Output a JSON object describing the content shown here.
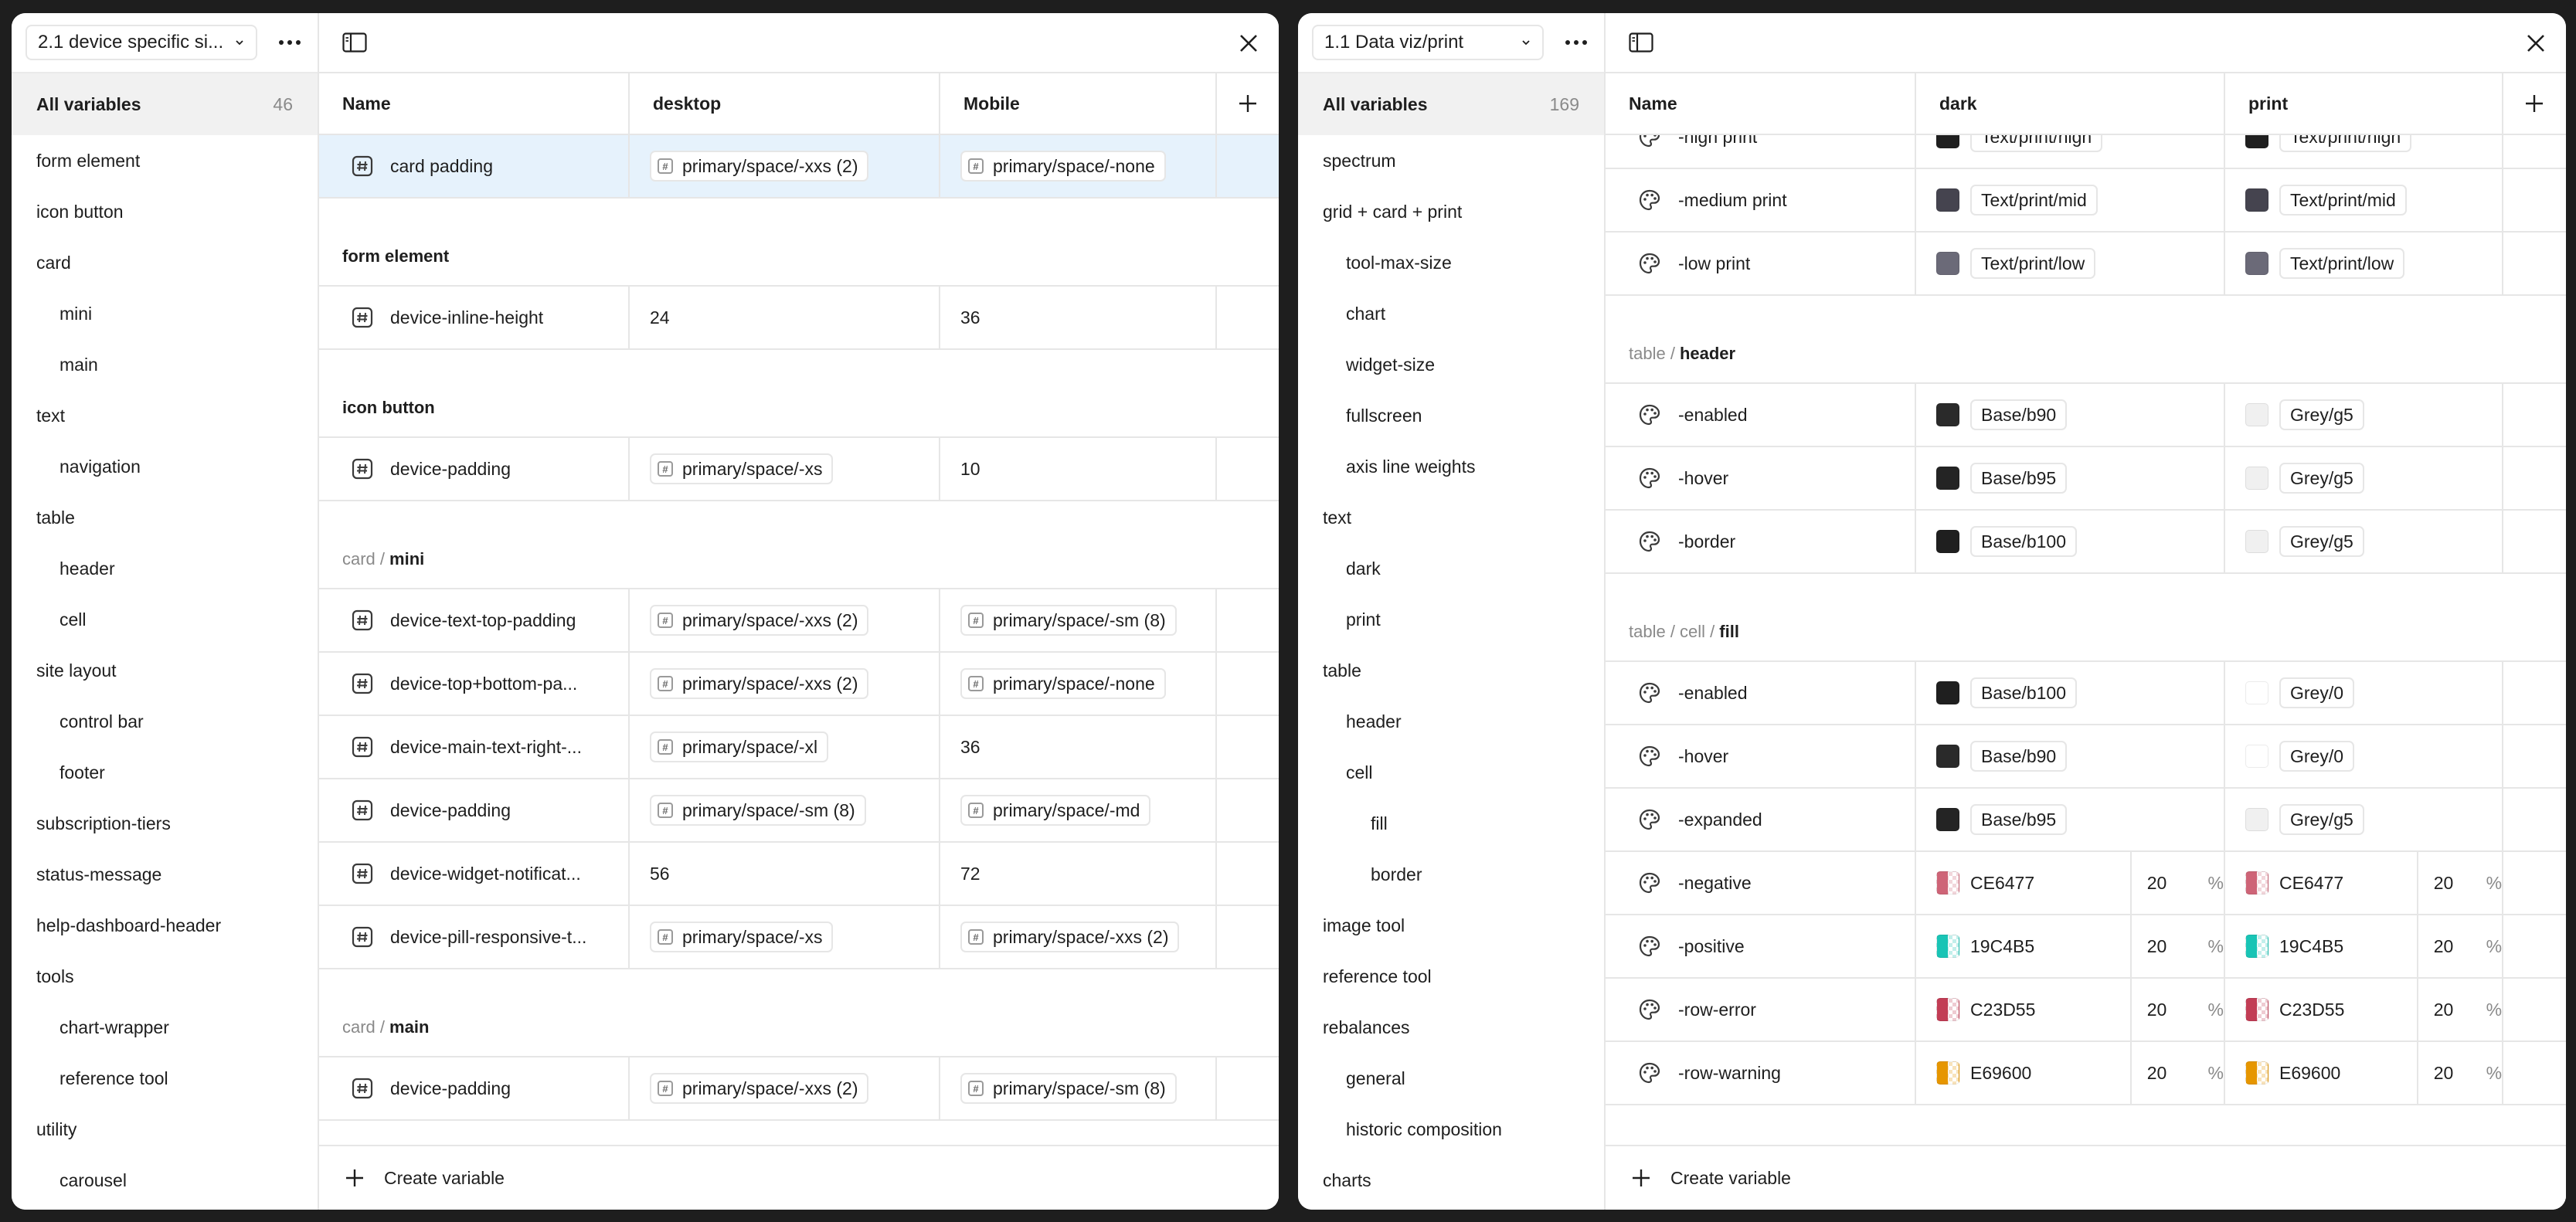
{
  "left": {
    "collection": "2.1 device specific si...",
    "all_variables": {
      "label": "All variables",
      "count": "46"
    },
    "groups": [
      {
        "label": "form element",
        "level": 0
      },
      {
        "label": "icon button",
        "level": 0
      },
      {
        "label": "card",
        "level": 0
      },
      {
        "label": "mini",
        "level": 1
      },
      {
        "label": "main",
        "level": 1
      },
      {
        "label": "text",
        "level": 0
      },
      {
        "label": "navigation",
        "level": 1
      },
      {
        "label": "table",
        "level": 0
      },
      {
        "label": "header",
        "level": 1
      },
      {
        "label": "cell",
        "level": 1
      },
      {
        "label": "site layout",
        "level": 0
      },
      {
        "label": "control bar",
        "level": 1
      },
      {
        "label": "footer",
        "level": 1
      },
      {
        "label": "subscription-tiers",
        "level": 0
      },
      {
        "label": "status-message",
        "level": 0
      },
      {
        "label": "help-dashboard-header",
        "level": 0
      },
      {
        "label": "tools",
        "level": 0
      },
      {
        "label": "chart-wrapper",
        "level": 1
      },
      {
        "label": "reference tool",
        "level": 1
      },
      {
        "label": "utility",
        "level": 0
      },
      {
        "label": "carousel",
        "level": 1
      }
    ],
    "columns": [
      "Name",
      "desktop",
      "Mobile"
    ],
    "blocks": [
      {
        "rows": [
          {
            "name": "card padding",
            "selected": true,
            "v1": {
              "kind": "alias",
              "text": "primary/space/-xxs (2)"
            },
            "v2": {
              "kind": "alias",
              "text": "primary/space/-none"
            }
          }
        ]
      },
      {
        "heading": {
          "path": "",
          "leaf": "form element"
        },
        "rows": [
          {
            "name": "device-inline-height",
            "v1": {
              "kind": "num",
              "text": "24"
            },
            "v2": {
              "kind": "num",
              "text": "36"
            }
          }
        ]
      },
      {
        "heading": {
          "path": "",
          "leaf": "icon button"
        },
        "rows": [
          {
            "name": "device-padding",
            "v1": {
              "kind": "alias",
              "text": "primary/space/-xs"
            },
            "v2": {
              "kind": "num",
              "text": "10"
            }
          }
        ]
      },
      {
        "heading": {
          "path": "card /",
          "leaf": "mini"
        },
        "rows": [
          {
            "name": "device-text-top-padding",
            "v1": {
              "kind": "alias",
              "text": "primary/space/-xxs (2)"
            },
            "v2": {
              "kind": "alias",
              "text": "primary/space/-sm (8)"
            }
          },
          {
            "name": "device-top+bottom-pa...",
            "v1": {
              "kind": "alias",
              "text": "primary/space/-xxs (2)"
            },
            "v2": {
              "kind": "alias",
              "text": "primary/space/-none"
            }
          },
          {
            "name": "device-main-text-right-...",
            "v1": {
              "kind": "alias",
              "text": "primary/space/-xl"
            },
            "v2": {
              "kind": "num",
              "text": "36"
            }
          },
          {
            "name": "device-padding",
            "v1": {
              "kind": "alias",
              "text": "primary/space/-sm (8)"
            },
            "v2": {
              "kind": "alias",
              "text": "primary/space/-md"
            }
          },
          {
            "name": "device-widget-notificat...",
            "v1": {
              "kind": "num",
              "text": "56"
            },
            "v2": {
              "kind": "num",
              "text": "72"
            }
          },
          {
            "name": "device-pill-responsive-t...",
            "v1": {
              "kind": "alias",
              "text": "primary/space/-xs"
            },
            "v2": {
              "kind": "alias",
              "text": "primary/space/-xxs (2)"
            }
          }
        ]
      },
      {
        "heading": {
          "path": "card /",
          "leaf": "main"
        },
        "rows": [
          {
            "name": "device-padding",
            "v1": {
              "kind": "alias",
              "text": "primary/space/-xxs (2)"
            },
            "v2": {
              "kind": "alias",
              "text": "primary/space/-sm (8)"
            }
          }
        ]
      }
    ],
    "create_label": "Create variable"
  },
  "right": {
    "collection": "1.1 Data viz/print",
    "all_variables": {
      "label": "All variables",
      "count": "169"
    },
    "groups": [
      {
        "label": "spectrum",
        "level": 0
      },
      {
        "label": "grid + card + print",
        "level": 0
      },
      {
        "label": "tool-max-size",
        "level": 1
      },
      {
        "label": "chart",
        "level": 1
      },
      {
        "label": "widget-size",
        "level": 1
      },
      {
        "label": "fullscreen",
        "level": 1
      },
      {
        "label": "axis line weights",
        "level": 1
      },
      {
        "label": "text",
        "level": 0
      },
      {
        "label": "dark",
        "level": 1
      },
      {
        "label": "print",
        "level": 1
      },
      {
        "label": "table",
        "level": 0
      },
      {
        "label": "header",
        "level": 1
      },
      {
        "label": "cell",
        "level": 1
      },
      {
        "label": "fill",
        "level": 2
      },
      {
        "label": "border",
        "level": 2
      },
      {
        "label": "image tool",
        "level": 0
      },
      {
        "label": "reference tool",
        "level": 0
      },
      {
        "label": "rebalances",
        "level": 0
      },
      {
        "label": "general",
        "level": 1
      },
      {
        "label": "historic composition",
        "level": 1
      },
      {
        "label": "charts",
        "level": 0
      }
    ],
    "columns": [
      "Name",
      "dark",
      "print"
    ],
    "blocks": [
      {
        "rows": [
          {
            "name": "-high print",
            "v1": {
              "kind": "color",
              "swatch": "#1f1f1f",
              "text": "Text/print/high"
            },
            "v2": {
              "kind": "color",
              "swatch": "#1f1f1f",
              "text": "Text/print/high"
            }
          },
          {
            "name": "-medium print",
            "v1": {
              "kind": "color",
              "swatch": "#45444f",
              "text": "Text/print/mid"
            },
            "v2": {
              "kind": "color",
              "swatch": "#45444f",
              "text": "Text/print/mid"
            }
          },
          {
            "name": "-low print",
            "v1": {
              "kind": "color",
              "swatch": "#6b6a78",
              "text": "Text/print/low"
            },
            "v2": {
              "kind": "color",
              "swatch": "#6b6a78",
              "text": "Text/print/low"
            }
          }
        ]
      },
      {
        "heading": {
          "path": "table /",
          "leaf": "header"
        },
        "rows": [
          {
            "name": "-enabled",
            "v1": {
              "kind": "color",
              "swatch": "#2a2a2a",
              "text": "Base/b90"
            },
            "v2": {
              "kind": "color",
              "swatch": "#f0f0f0",
              "text": "Grey/g5"
            }
          },
          {
            "name": "-hover",
            "v1": {
              "kind": "color",
              "swatch": "#242424",
              "text": "Base/b95"
            },
            "v2": {
              "kind": "color",
              "swatch": "#f0f0f0",
              "text": "Grey/g5"
            }
          },
          {
            "name": "-border",
            "v1": {
              "kind": "color",
              "swatch": "#1f1f1f",
              "text": "Base/b100"
            },
            "v2": {
              "kind": "color",
              "swatch": "#f0f0f0",
              "text": "Grey/g5"
            }
          }
        ]
      },
      {
        "heading": {
          "path": "table / cell /",
          "leaf": "fill"
        },
        "rows": [
          {
            "name": "-enabled",
            "v1": {
              "kind": "color",
              "swatch": "#1f1f1f",
              "text": "Base/b100"
            },
            "v2": {
              "kind": "color",
              "swatch": "#ffffff",
              "text": "Grey/0"
            }
          },
          {
            "name": "-hover",
            "v1": {
              "kind": "color",
              "swatch": "#2a2a2a",
              "text": "Base/b90"
            },
            "v2": {
              "kind": "color",
              "swatch": "#ffffff",
              "text": "Grey/0"
            }
          },
          {
            "name": "-expanded",
            "v1": {
              "kind": "color",
              "swatch": "#242424",
              "text": "Base/b95"
            },
            "v2": {
              "kind": "color",
              "swatch": "#f0f0f0",
              "text": "Grey/g5"
            }
          },
          {
            "name": "-negative",
            "v1": {
              "kind": "hex",
              "swatch": "#CE6477",
              "text": "CE6477",
              "opacity": "20",
              "unit": "%"
            },
            "v2": {
              "kind": "hex",
              "swatch": "#CE6477",
              "text": "CE6477",
              "opacity": "20",
              "unit": "%"
            }
          },
          {
            "name": "-positive",
            "v1": {
              "kind": "hex",
              "swatch": "#19C4B5",
              "text": "19C4B5",
              "opacity": "20",
              "unit": "%"
            },
            "v2": {
              "kind": "hex",
              "swatch": "#19C4B5",
              "text": "19C4B5",
              "opacity": "20",
              "unit": "%"
            }
          },
          {
            "name": "-row-error",
            "v1": {
              "kind": "hex",
              "swatch": "#C23D55",
              "text": "C23D55",
              "opacity": "20",
              "unit": "%"
            },
            "v2": {
              "kind": "hex",
              "swatch": "#C23D55",
              "text": "C23D55",
              "opacity": "20",
              "unit": "%"
            }
          },
          {
            "name": "-row-warning",
            "v1": {
              "kind": "hex",
              "swatch": "#E69600",
              "text": "E69600",
              "opacity": "20",
              "unit": "%"
            },
            "v2": {
              "kind": "hex",
              "swatch": "#E69600",
              "text": "E69600",
              "opacity": "20",
              "unit": "%"
            }
          }
        ]
      }
    ],
    "create_label": "Create variable"
  }
}
